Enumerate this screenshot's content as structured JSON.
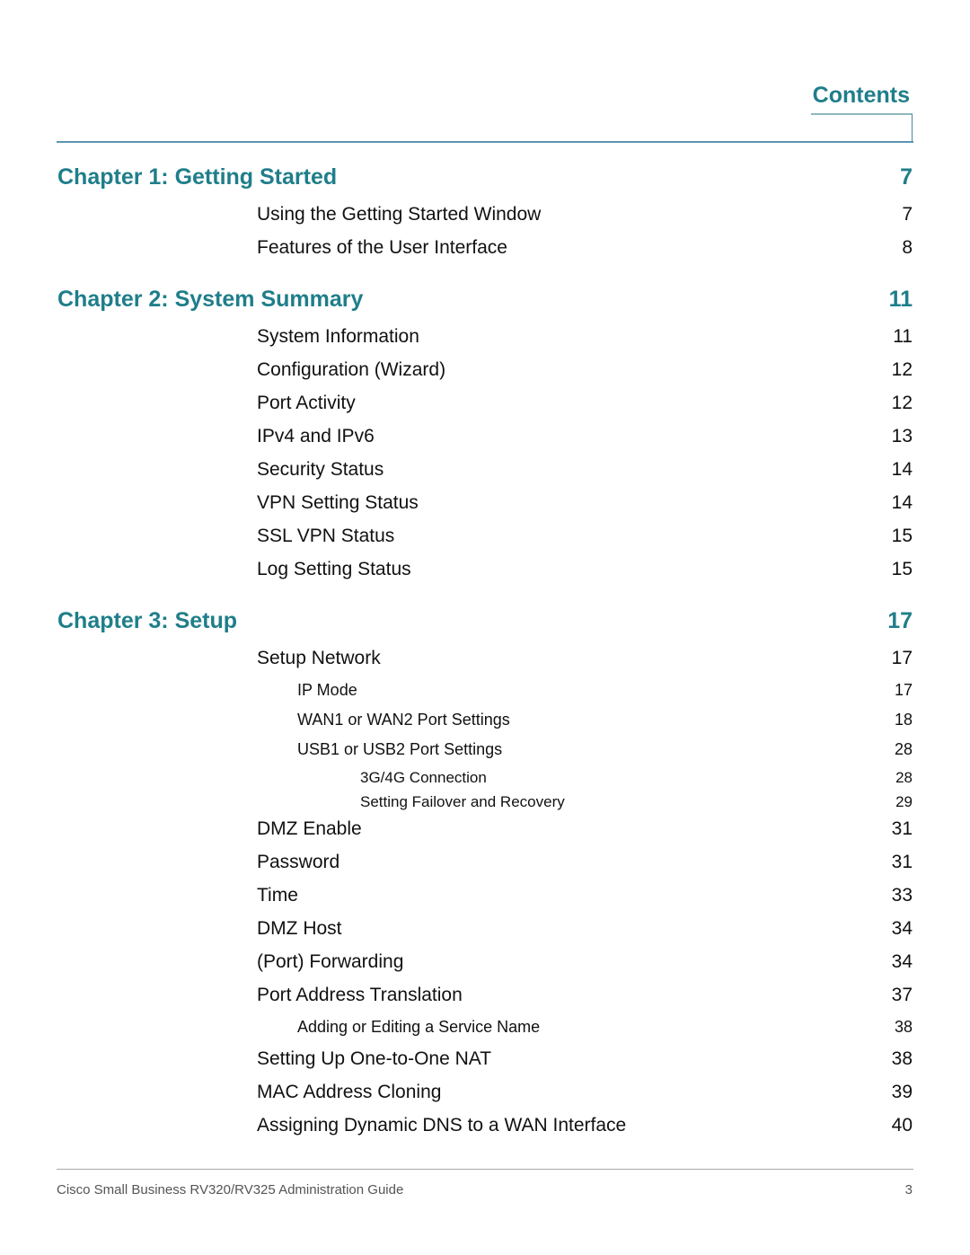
{
  "header": {
    "title": "Contents"
  },
  "toc": [
    {
      "level": "ch",
      "title": "Chapter 1: Getting Started",
      "page": "7"
    },
    {
      "level": "l1",
      "title": "Using the Getting Started Window",
      "page": "7"
    },
    {
      "level": "l1",
      "title": "Features of the User Interface",
      "page": "8"
    },
    {
      "level": "ch",
      "title": "Chapter 2: System Summary",
      "page": "11"
    },
    {
      "level": "l1",
      "title": "System Information",
      "page": "11"
    },
    {
      "level": "l1",
      "title": "Configuration (Wizard)",
      "page": "12"
    },
    {
      "level": "l1",
      "title": "Port Activity",
      "page": "12"
    },
    {
      "level": "l1",
      "title": "IPv4 and IPv6",
      "page": "13"
    },
    {
      "level": "l1",
      "title": "Security Status",
      "page": "14"
    },
    {
      "level": "l1",
      "title": "VPN Setting Status",
      "page": "14"
    },
    {
      "level": "l1",
      "title": "SSL VPN Status",
      "page": "15"
    },
    {
      "level": "l1",
      "title": "Log Setting Status",
      "page": "15"
    },
    {
      "level": "ch",
      "title": "Chapter 3: Setup",
      "page": "17"
    },
    {
      "level": "l1",
      "title": "Setup Network",
      "page": "17"
    },
    {
      "level": "l2",
      "title": "IP Mode",
      "page": "17"
    },
    {
      "level": "l2",
      "title": "WAN1 or WAN2 Port Settings",
      "page": "18"
    },
    {
      "level": "l2",
      "title": "USB1 or USB2 Port Settings",
      "page": "28"
    },
    {
      "level": "l3",
      "title": "3G/4G Connection",
      "page": "28"
    },
    {
      "level": "l3",
      "title": "Setting Failover and Recovery",
      "page": "29"
    },
    {
      "level": "l1",
      "title": "DMZ Enable",
      "page": "31"
    },
    {
      "level": "l1",
      "title": "Password",
      "page": "31"
    },
    {
      "level": "l1",
      "title": "Time",
      "page": "33"
    },
    {
      "level": "l1",
      "title": "DMZ Host",
      "page": "34"
    },
    {
      "level": "l1",
      "title": "(Port) Forwarding",
      "page": "34"
    },
    {
      "level": "l1",
      "title": "Port Address Translation",
      "page": "37"
    },
    {
      "level": "l2",
      "title": "Adding or Editing a Service Name",
      "page": "38"
    },
    {
      "level": "l1",
      "title": "Setting Up One-to-One NAT",
      "page": "38"
    },
    {
      "level": "l1",
      "title": "MAC Address Cloning",
      "page": "39"
    },
    {
      "level": "l1",
      "title": "Assigning Dynamic DNS to a WAN Interface",
      "page": "40"
    }
  ],
  "footer": {
    "text": "Cisco Small Business RV320/RV325  Administration Guide",
    "page_number": "3"
  },
  "colors": {
    "accent": "#1f7e8a",
    "rule": "#5d95b3"
  }
}
